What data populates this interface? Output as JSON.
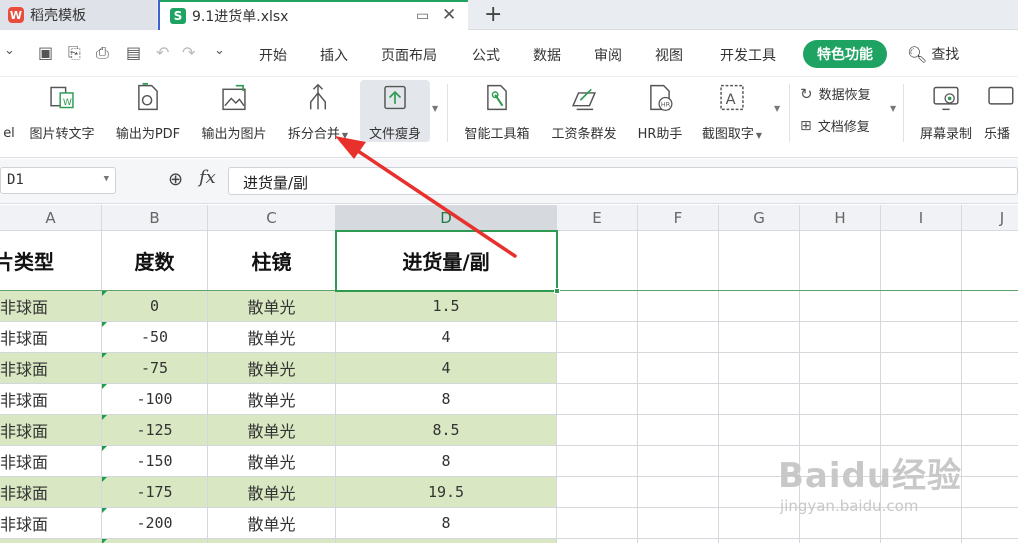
{
  "tabs": {
    "docer_label": "稻壳模板",
    "doc_label": "9.1进货单.xlsx",
    "new_tab": "+"
  },
  "menu": {
    "items": [
      "开始",
      "插入",
      "页面布局",
      "公式",
      "数据",
      "审阅",
      "视图",
      "开发工具"
    ],
    "special": "特色功能",
    "search": "查找"
  },
  "ribbon": {
    "cut_label": "el",
    "buttons": [
      {
        "label": "图片转文字",
        "icon": "image-to-text-icon"
      },
      {
        "label": "输出为PDF",
        "icon": "export-pdf-icon"
      },
      {
        "label": "输出为图片",
        "icon": "export-image-icon"
      },
      {
        "label": "拆分合并",
        "icon": "split-merge-icon"
      },
      {
        "label": "文件瘦身",
        "icon": "file-slim-icon"
      },
      {
        "label": "智能工具箱",
        "icon": "smart-toolbox-icon"
      },
      {
        "label": "工资条群发",
        "icon": "payslip-send-icon"
      },
      {
        "label": "HR助手",
        "icon": "hr-assistant-icon"
      },
      {
        "label": "截图取字",
        "icon": "screenshot-ocr-icon"
      },
      {
        "label": "屏幕录制",
        "icon": "screen-record-icon"
      },
      {
        "label": "乐播",
        "icon": "leplay-icon"
      }
    ],
    "data_recovery": "数据恢复",
    "doc_repair": "文档修复"
  },
  "formula_bar": {
    "cell_ref": "D1",
    "fx": "fx",
    "content": "进货量/副"
  },
  "columns": [
    "A",
    "B",
    "C",
    "D",
    "E",
    "F",
    "G",
    "H",
    "I",
    "J"
  ],
  "selected_column": "D",
  "table": {
    "headers": [
      "片类型",
      "度数",
      "柱镜",
      "进货量/副"
    ],
    "rows": [
      [
        "非球面",
        "0",
        "散单光",
        "1.5"
      ],
      [
        "非球面",
        "-50",
        "散单光",
        "4"
      ],
      [
        "非球面",
        "-75",
        "散单光",
        "4"
      ],
      [
        "非球面",
        "-100",
        "散单光",
        "8"
      ],
      [
        "非球面",
        "-125",
        "散单光",
        "8.5"
      ],
      [
        "非球面",
        "-150",
        "散单光",
        "8"
      ],
      [
        "非球面",
        "-175",
        "散单光",
        "19.5"
      ],
      [
        "非球面",
        "-200",
        "散单光",
        "8"
      ]
    ]
  },
  "colors": {
    "accent": "#1fa363",
    "row_green": "#d9e8c2",
    "arrow": "#e8302c"
  },
  "watermark": {
    "main": "Baidu经验",
    "sub": "jingyan.baidu.com"
  }
}
